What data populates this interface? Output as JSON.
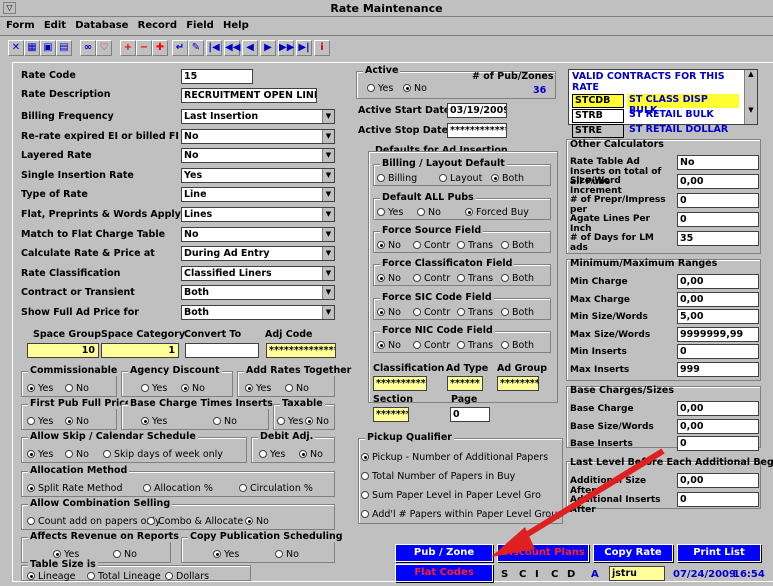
{
  "window": {
    "title": "Rate Maintenance",
    "sys": "▽"
  },
  "menu": [
    "Form",
    "Edit",
    "Database",
    "Record",
    "Field",
    "Help"
  ],
  "toolbar": [
    "✕",
    "▦",
    "▣",
    "▤",
    "∞",
    "♡",
    "+",
    "−",
    "✚",
    "↵",
    "✎",
    "|◀",
    "◀◀",
    "◀",
    "▶",
    "▶▶",
    "▶|",
    "i"
  ],
  "left": {
    "rate_code": {
      "label": "Rate Code",
      "value": "15"
    },
    "rate_description": {
      "label": "Rate Description",
      "value": "RECRUITMENT OPEN LINER"
    },
    "rows": [
      {
        "label": "Billing Frequency",
        "value": "Last Insertion"
      },
      {
        "label": "Re-rate expired EI or billed FI Ads",
        "value": "No"
      },
      {
        "label": "Layered Rate",
        "value": "No"
      },
      {
        "label": "Single Insertion Rate",
        "value": "Yes"
      },
      {
        "label": "Type of Rate",
        "value": "Line"
      },
      {
        "label": "Flat, Preprints & Words Apply as",
        "value": "Lines"
      },
      {
        "label": "Match to Flat Charge Table",
        "value": "No"
      },
      {
        "label": "Calculate Rate & Price at",
        "value": "During Ad Entry"
      },
      {
        "label": "Rate Classification",
        "value": "Classified Liners"
      },
      {
        "label": "Contract or Transient",
        "value": "Both"
      },
      {
        "label": "Show Full Ad Price for",
        "value": "Both"
      }
    ],
    "space_group_label": "Space Group",
    "space_category_label": "Space Category",
    "convert_to_label": "Convert To",
    "adj_code_label": "Adj Code",
    "space_group": "10",
    "space_category": "1",
    "convert_to": "",
    "adj_code": "****************"
  },
  "groups": {
    "commissionable": {
      "title": "Commissionable",
      "opts": [
        "Yes",
        "No"
      ],
      "on": 0
    },
    "agency_discount": {
      "title": "Agency Discount",
      "opts": [
        "Yes",
        "No"
      ],
      "on": 1
    },
    "add_rates_together": {
      "title": "Add Rates Together",
      "opts": [
        "Yes",
        "No"
      ],
      "on": 0
    },
    "first_pub_full": {
      "title": "First Pub Full Price",
      "opts": [
        "Yes",
        "No"
      ],
      "on": 1
    },
    "base_charge_times": {
      "title": "Base Charge Times Inserts",
      "opts": [
        "Yes",
        "No"
      ],
      "on": 0
    },
    "taxable": {
      "title": "Taxable",
      "opts": [
        "Yes",
        "No"
      ],
      "on": 1
    },
    "allow_skip": {
      "title": "Allow Skip / Calendar Schedule",
      "opts": [
        "Yes",
        "No",
        "Skip days of week only"
      ],
      "on": 0
    },
    "debit_adj": {
      "title": "Debit Adj.",
      "opts": [
        "Yes",
        "No"
      ],
      "on": 1
    },
    "allocation": {
      "title": "Allocation Method",
      "opts": [
        "Split Rate Method",
        "Allocation %",
        "Circulation %"
      ],
      "on": 0
    },
    "combination": {
      "title": "Allow Combination Selling",
      "opts": [
        "Count add on papers only",
        "Combo & Allocate",
        "No"
      ],
      "on": 2
    },
    "affects_revenue": {
      "title": "Affects Revenue on Reports",
      "opts": [
        "Yes",
        "No"
      ],
      "on": 0
    },
    "copy_pub": {
      "title": "Copy Publication Scheduling",
      "opts": [
        "Yes",
        "No"
      ],
      "on": 0
    },
    "table_size": {
      "title": "Table Size is",
      "opts": [
        "Lineage",
        "Total Lineage",
        "Dollars"
      ],
      "on": 0
    }
  },
  "mid": {
    "active": {
      "title": "Active",
      "opts": [
        "Yes",
        "No"
      ],
      "on": 1
    },
    "pubzones_label": "# of Pub/Zones",
    "pubzones": "36",
    "active_start_label": "Active Start Date",
    "active_start": "03/19/2009",
    "active_stop_label": "Active Stop Date",
    "active_stop": "************",
    "defaults_title": "Defaults for Ad Insertion",
    "billing_layout": {
      "title": "Billing / Layout Default",
      "opts": [
        "Billing",
        "Layout",
        "Both"
      ],
      "on": 2
    },
    "default_all_pubs": {
      "title": "Default ALL Pubs",
      "opts": [
        "Yes",
        "No",
        "Forced Buy"
      ],
      "on": 2
    },
    "force_source": {
      "title": "Force Source Field",
      "opts": [
        "No",
        "Contr",
        "Trans",
        "Both"
      ],
      "on": 0
    },
    "force_class": {
      "title": "Force Classificaton Field",
      "opts": [
        "No",
        "Contr",
        "Trans",
        "Both"
      ],
      "on": 0
    },
    "force_sic": {
      "title": "Force SIC Code Field",
      "opts": [
        "No",
        "Contr",
        "Trans",
        "Both"
      ],
      "on": 0
    },
    "force_nic": {
      "title": "Force NIC Code Field",
      "opts": [
        "No",
        "Contr",
        "Trans",
        "Both"
      ],
      "on": 0
    },
    "classification_label": "Classification",
    "classification": "************",
    "adtype_label": "Ad Type",
    "adtype": "******",
    "adgroup_label": "Ad Group",
    "adgroup": "********",
    "section_label": "Section",
    "section": "********",
    "page_label": "Page",
    "page": "0",
    "pickup": {
      "title": "Pickup Qualifier",
      "opts": [
        "Pickup - Number of Additional Papers",
        "Total Number of Papers in Buy",
        "Sum Paper Level in Paper Level Gro",
        "Add'l # Papers within Paper Level Group"
      ],
      "on": 0
    }
  },
  "right": {
    "contracts_header": "VALID CONTRACTS FOR THIS RATE",
    "contracts": [
      [
        "STCDB",
        "ST CLASS DISP BULK"
      ],
      [
        "STRB",
        "ST RETAIL BULK"
      ],
      [
        "STRE",
        "ST RETAIL DOLLAR"
      ]
    ],
    "other_calc_title": "Other Calculators",
    "other": [
      {
        "label": "Rate Table Ad Inserts on total of all Pubs",
        "value": "No"
      },
      {
        "label": "Size/Word Increment",
        "value": "0,00"
      },
      {
        "label": "# of Prepr/Impress per",
        "value": "0"
      },
      {
        "label": "Agate Lines Per Inch",
        "value": "0"
      },
      {
        "label": "# of Days for LM ads",
        "value": "35"
      }
    ],
    "minmax_title": "Minimum/Maximum Ranges",
    "minmax": [
      {
        "label": "Min Charge",
        "value": "0,00"
      },
      {
        "label": "Max Charge",
        "value": "0,00"
      },
      {
        "label": "Min Size/Words",
        "value": "5,00"
      },
      {
        "label": "Max Size/Words",
        "value": "9999999,99"
      },
      {
        "label": "Min Inserts",
        "value": "0"
      },
      {
        "label": "Max Inserts",
        "value": "999"
      }
    ],
    "base_title": "Base Charges/Sizes",
    "base": [
      {
        "label": "Base Charge",
        "value": "0,00"
      },
      {
        "label": "Base Size/Words",
        "value": "0,00"
      },
      {
        "label": "Base Inserts",
        "value": "0"
      }
    ],
    "last_title": "Last Level Before Each Additional Begins",
    "last": [
      {
        "label": "Additional Size After",
        "value": "0,00"
      },
      {
        "label": "Additional Inserts After",
        "value": "0"
      }
    ]
  },
  "buttons": {
    "pub_zone": "Pub / Zone Detail",
    "discount": "Discount Plans",
    "copy_rate": "Copy Rate",
    "print_list": "Print List",
    "flat_codes": "Flat Codes"
  },
  "status": {
    "s": "S",
    "c": "C",
    "i": "I",
    "c2": "C",
    "d": "D",
    "a": "A",
    "user": "jstru",
    "date": "07/24/2009",
    "time": "16:54"
  }
}
